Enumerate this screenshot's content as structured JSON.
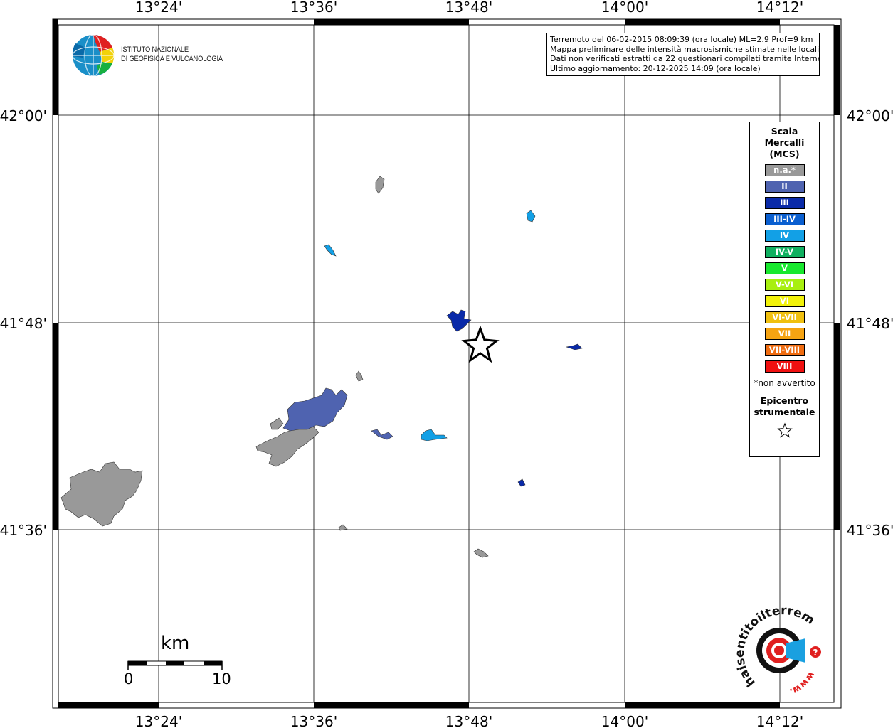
{
  "map": {
    "top_ticks": [
      "13°24'",
      "13°36'",
      "13°48'",
      "14°00'",
      "14°12'"
    ],
    "bottom_ticks": [
      "13°24'",
      "13°36'",
      "13°48'",
      "14°00'",
      "14°12'"
    ],
    "left_ticks": [
      "42°00'",
      "41°48'",
      "41°36'"
    ],
    "right_ticks": [
      "42°00'",
      "41°48'",
      "41°36'"
    ]
  },
  "institute": {
    "line1": "ISTITUTO NAZIONALE",
    "line2": "DI GEOFISICA E VULCANOLOGIA"
  },
  "info": {
    "line1": "Terremoto del 06-02-2015 08:09:39 (ora locale) ML=2.9 Prof=9 km",
    "line2": "Mappa preliminare delle intensità macrosismiche stimate nelle località",
    "line3": "Dati non verificati estratti da 22 questionari compilati tramite Internet.",
    "line4": "Ultimo aggiornamento: 20-12-2025 14:09 (ora locale)"
  },
  "legend": {
    "title1": "Scala",
    "title2": "Mercalli",
    "title3": "(MCS)",
    "items": [
      {
        "label": "n.a.*",
        "color": "#999999"
      },
      {
        "label": "II",
        "color": "#4f63b0"
      },
      {
        "label": "III",
        "color": "#0a2aa8"
      },
      {
        "label": "III-IV",
        "color": "#0a5fd0"
      },
      {
        "label": "IV",
        "color": "#12a0e6"
      },
      {
        "label": "IV-V",
        "color": "#10b060"
      },
      {
        "label": "V",
        "color": "#18e82e"
      },
      {
        "label": "V-VI",
        "color": "#a8ef10"
      },
      {
        "label": "VI",
        "color": "#f2f20a"
      },
      {
        "label": "VI-VII",
        "color": "#f0c010"
      },
      {
        "label": "VII",
        "color": "#f5a312"
      },
      {
        "label": "VII-VIII",
        "color": "#f06c10"
      },
      {
        "label": "VIII",
        "color": "#f01010"
      }
    ],
    "note": "*non avvertito",
    "epicenter1": "Epicentro",
    "epicenter2": "strumentale"
  },
  "scale_bar": {
    "unit": "km",
    "start": "0",
    "end": "10"
  },
  "watermark": {
    "text_arc": "haisentitoilterremoto.it",
    "text_www": "www."
  }
}
